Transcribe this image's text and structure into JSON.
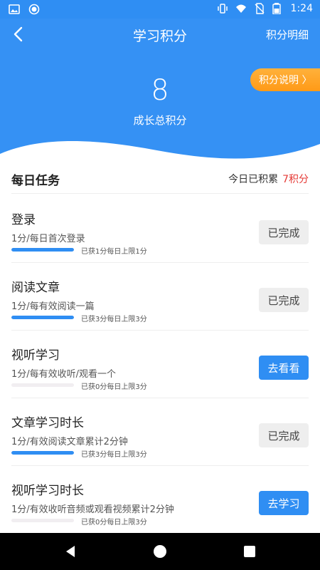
{
  "status_bar": {
    "time": "1:24",
    "left_icons": [
      "image-icon",
      "circle-notification-icon"
    ],
    "right_icons": [
      "vibrate-icon",
      "wifi-icon",
      "no-sim-icon",
      "battery-icon"
    ]
  },
  "header": {
    "title": "学习积分",
    "right_link": "积分明细",
    "rules_button": "积分说明 〉",
    "total_points": "8",
    "total_points_label": "成长总积分"
  },
  "daily": {
    "title": "每日任务",
    "today_label": "今日已积累",
    "today_points": "7积分",
    "tasks": [
      {
        "title": "登录",
        "desc": "1分/每日首次登录",
        "meta": "已获1分每日上限1分",
        "progress": 1.0,
        "button": "已完成",
        "done": true
      },
      {
        "title": "阅读文章",
        "desc": "1分/每有效阅读一篇",
        "meta": "已获3分每日上限3分",
        "progress": 1.0,
        "button": "已完成",
        "done": true
      },
      {
        "title": "视听学习",
        "desc": "1分/每有效收听/观看一个",
        "meta": "已获0分每日上限3分",
        "progress": 0.0,
        "button": "去看看",
        "done": false
      },
      {
        "title": "文章学习时长",
        "desc": "1分/有效阅读文章累计2分钟",
        "meta": "已获3分每日上限3分",
        "progress": 1.0,
        "button": "已完成",
        "done": true
      },
      {
        "title": "视听学习时长",
        "desc": "1分/有效收听音频或观看视频累计2分钟",
        "meta": "已获0分每日上限3分",
        "progress": 0.0,
        "button": "去学习",
        "done": false
      }
    ]
  },
  "colors": {
    "primary": "#2f8ef3",
    "accent_orange": "#ff9a17",
    "highlight_red": "#e53935"
  }
}
